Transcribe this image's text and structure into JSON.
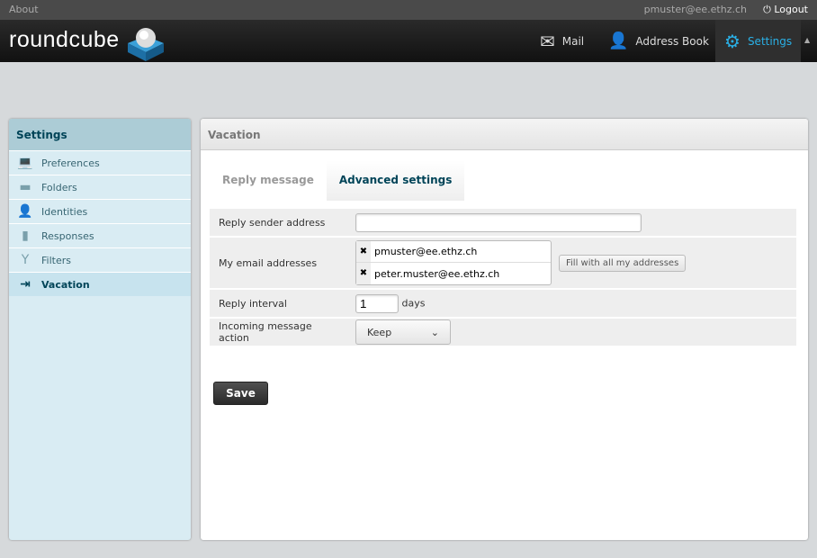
{
  "topline": {
    "about": "About",
    "user": "pmuster@ee.ethz.ch",
    "logout": "Logout"
  },
  "header": {
    "logo": "roundcube",
    "nav": [
      {
        "label": "Mail",
        "icon": "envelope-icon"
      },
      {
        "label": "Address Book",
        "icon": "person-icon"
      },
      {
        "label": "Settings",
        "icon": "gear-icon",
        "active": true
      }
    ]
  },
  "sidebar": {
    "title": "Settings",
    "items": [
      {
        "label": "Preferences",
        "icon": "laptop-icon"
      },
      {
        "label": "Folders",
        "icon": "folder-icon"
      },
      {
        "label": "Identities",
        "icon": "person-icon"
      },
      {
        "label": "Responses",
        "icon": "document-icon"
      },
      {
        "label": "Filters",
        "icon": "funnel-icon"
      },
      {
        "label": "Vacation",
        "icon": "exit-icon",
        "selected": true
      }
    ]
  },
  "main": {
    "title": "Vacation",
    "tabs": [
      {
        "label": "Reply message"
      },
      {
        "label": "Advanced settings",
        "active": true
      }
    ],
    "form": {
      "reply_sender_label": "Reply sender address",
      "reply_sender_value": "",
      "my_emails_label": "My email addresses",
      "emails": [
        "pmuster@ee.ethz.ch",
        "peter.muster@ee.ethz.ch"
      ],
      "fill_button": "Fill with all my addresses",
      "interval_label": "Reply interval",
      "interval_value": "1",
      "interval_unit": "days",
      "action_label": "Incoming message action",
      "action_value": "Keep"
    },
    "save": "Save"
  },
  "colors": {
    "accent": "#2ab0e6",
    "sidebar_title": "#004458"
  }
}
